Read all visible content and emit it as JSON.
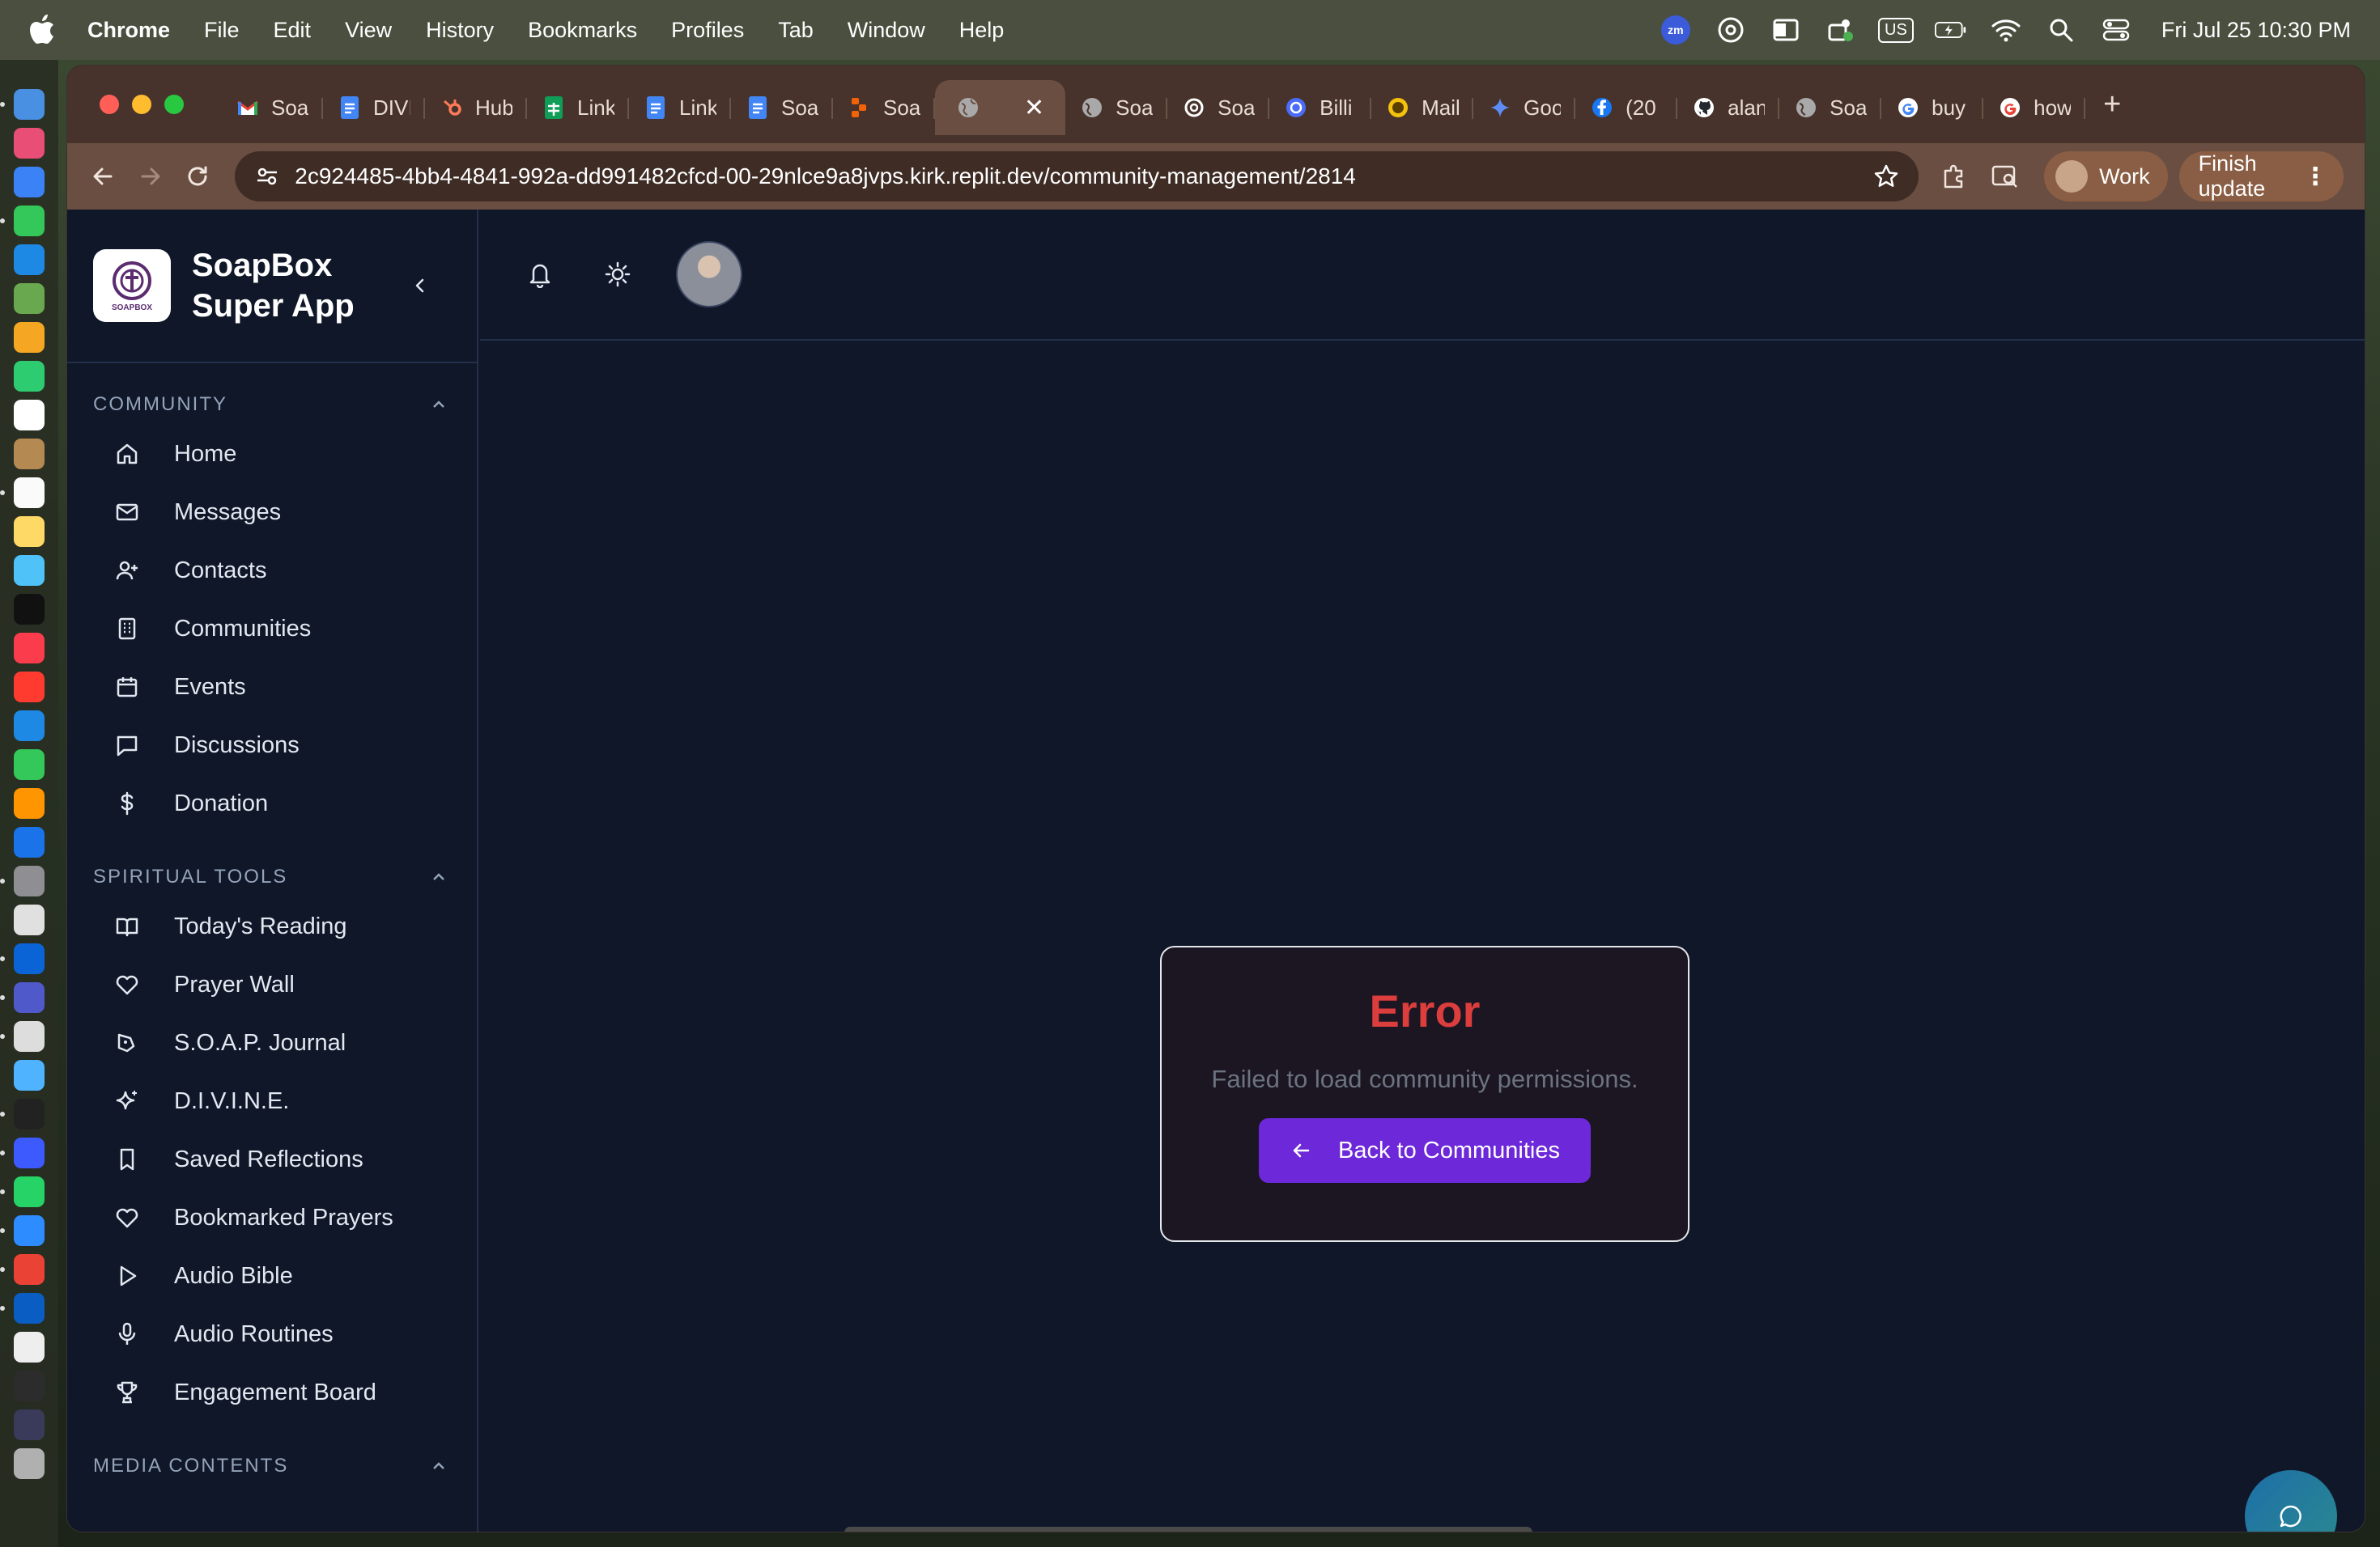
{
  "menubar": {
    "app_name": "Chrome",
    "items": [
      "File",
      "Edit",
      "View",
      "History",
      "Bookmarks",
      "Profiles",
      "Tab",
      "Window",
      "Help"
    ],
    "zoom_badge": "zm",
    "keyboard": "US",
    "clock": "Fri Jul 25  10:30 PM"
  },
  "tabs": [
    {
      "title": "Soa",
      "icon": "gmail-icon"
    },
    {
      "title": "DIVI",
      "icon": "docs-icon"
    },
    {
      "title": "Hub",
      "icon": "hubspot-icon"
    },
    {
      "title": "Link",
      "icon": "sheets-icon"
    },
    {
      "title": "Link",
      "icon": "docs-icon"
    },
    {
      "title": "Soa",
      "icon": "docs-icon"
    },
    {
      "title": "Soa",
      "icon": "replit-icon"
    },
    {
      "title": "",
      "icon": "globe-icon",
      "active": true
    },
    {
      "title": "Soa",
      "icon": "globe-icon"
    },
    {
      "title": "Soa",
      "icon": "openai-icon"
    },
    {
      "title": "Billi",
      "icon": "openai-icon"
    },
    {
      "title": "Mail",
      "icon": "mail-icon"
    },
    {
      "title": "Goo",
      "icon": "gemini-icon"
    },
    {
      "title": "(20",
      "icon": "facebook-icon"
    },
    {
      "title": "alan",
      "icon": "github-icon"
    },
    {
      "title": "Soa",
      "icon": "globe-icon"
    },
    {
      "title": "buy",
      "icon": "google-icon"
    },
    {
      "title": "how",
      "icon": "google-icon"
    }
  ],
  "toolbar": {
    "url": "2c924485-4bb4-4841-992a-dd991482cfcd-00-29nlce9a8jvps.kirk.replit.dev/community-management/2814",
    "profile_label": "Work",
    "update_label": "Finish update"
  },
  "sidebar": {
    "brand_line1": "SoapBox",
    "brand_line2": "Super App",
    "logo_text": "SOAPBOX",
    "sections": [
      {
        "title": "COMMUNITY",
        "items": [
          {
            "label": "Home",
            "icon": "home-icon"
          },
          {
            "label": "Messages",
            "icon": "mail-icon"
          },
          {
            "label": "Contacts",
            "icon": "user-plus-icon"
          },
          {
            "label": "Communities",
            "icon": "building-icon"
          },
          {
            "label": "Events",
            "icon": "calendar-icon"
          },
          {
            "label": "Discussions",
            "icon": "message-square-icon"
          },
          {
            "label": "Donation",
            "icon": "dollar-icon"
          }
        ]
      },
      {
        "title": "SPIRITUAL TOOLS",
        "items": [
          {
            "label": "Today's Reading",
            "icon": "book-open-icon"
          },
          {
            "label": "Prayer Wall",
            "icon": "heart-icon"
          },
          {
            "label": "S.O.A.P. Journal",
            "icon": "pen-tool-icon"
          },
          {
            "label": "D.I.V.I.N.E.",
            "icon": "sparkles-icon"
          },
          {
            "label": "Saved Reflections",
            "icon": "bookmark-icon"
          },
          {
            "label": "Bookmarked Prayers",
            "icon": "heart-icon"
          },
          {
            "label": "Audio Bible",
            "icon": "play-icon"
          },
          {
            "label": "Audio Routines",
            "icon": "mic-icon"
          },
          {
            "label": "Engagement Board",
            "icon": "trophy-icon"
          }
        ]
      },
      {
        "title": "MEDIA CONTENTS",
        "items": []
      }
    ]
  },
  "error": {
    "title": "Error",
    "message": "Failed to load community permissions.",
    "button_label": "Back to Communities"
  },
  "colors": {
    "accent": "#6d28d9",
    "error": "#dc3d3d",
    "background": "#0f1729"
  }
}
